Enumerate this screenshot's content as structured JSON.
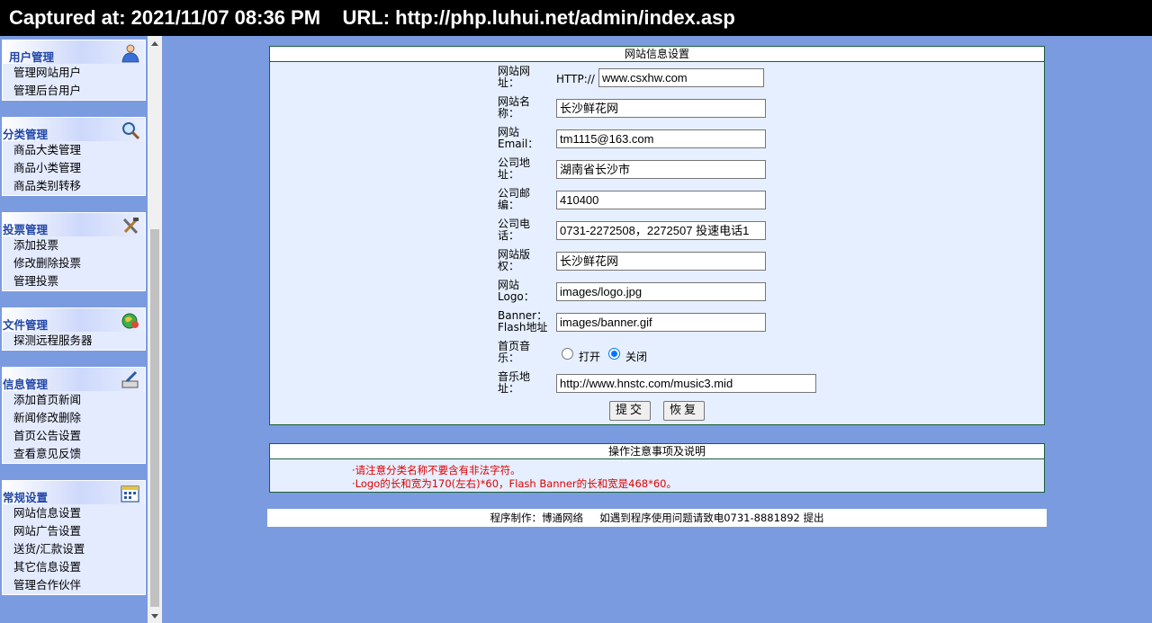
{
  "capture": {
    "text": "Captured at: 2021/11/07 08:36 PM    URL: http://php.luhui.net/admin/index.asp"
  },
  "sidebar": {
    "groups": [
      {
        "title": "用户管理",
        "icon": "user-icon",
        "items": [
          "管理网站用户",
          "管理后台用户"
        ]
      },
      {
        "title": "分类管理",
        "icon": "magnifier-icon",
        "items": [
          "商品大类管理",
          "商品小类管理",
          "商品类别转移"
        ]
      },
      {
        "title": "投票管理",
        "icon": "tools-icon",
        "items": [
          "添加投票",
          "修改删除投票",
          "管理投票"
        ]
      },
      {
        "title": "文件管理",
        "icon": "globe-icon",
        "items": [
          "探测远程服务器"
        ]
      },
      {
        "title": "信息管理",
        "icon": "pen-icon",
        "items": [
          "添加首页新闻",
          "新闻修改删除",
          "首页公告设置",
          "查看意见反馈"
        ]
      },
      {
        "title": "常规设置",
        "icon": "calendar-icon",
        "items": [
          "网站信息设置",
          "网站广告设置",
          "送货/汇款设置",
          "其它信息设置",
          "管理合作伙伴"
        ]
      }
    ]
  },
  "form": {
    "title": "网站信息设置",
    "site_url_label": "网站网址：",
    "site_url_prefix": "HTTP://",
    "site_url": "www.csxhw.com",
    "site_name_label": "网站名称：",
    "site_name": "长沙鲜花网",
    "email_label": "网站Email：",
    "email": "tm1115@163.com",
    "address_label": "公司地址：",
    "address": "湖南省长沙市",
    "postcode_label": "公司邮编：",
    "postcode": "410400",
    "phone_label": "公司电话：",
    "phone": "0731-2272508，2272507   投速电话1",
    "copyright_label": "网站版权：",
    "copyright": "长沙鲜花网",
    "logo_label": "网站Logo：",
    "logo": "images/logo.jpg",
    "banner_label": "Banner：Flash地址",
    "banner": "images/banner.gif",
    "music_label": "首页音乐：",
    "music_on": "打开",
    "music_off": "关闭",
    "music_selected": "关闭",
    "music_url_label": "音乐地址：",
    "music_url": "http://www.hnstc.com/music3.mid",
    "submit": "提交",
    "reset": "恢复"
  },
  "notes": {
    "title": "操作注意事项及说明",
    "lines": [
      "·请注意分类名称不要含有非法字符。",
      "·Logo的长和宽为170(左右)*60，Flash Banner的长和宽是468*60。"
    ]
  },
  "footer": {
    "text": "程序制作：博通网络     如遇到程序使用问题请致电0731-8881892 提出"
  },
  "colors": {
    "background": "#7b9be0",
    "panel": "#e6efff",
    "border": "#1b5e3a",
    "menu_title": "#2147a8",
    "note": "#e00000"
  }
}
